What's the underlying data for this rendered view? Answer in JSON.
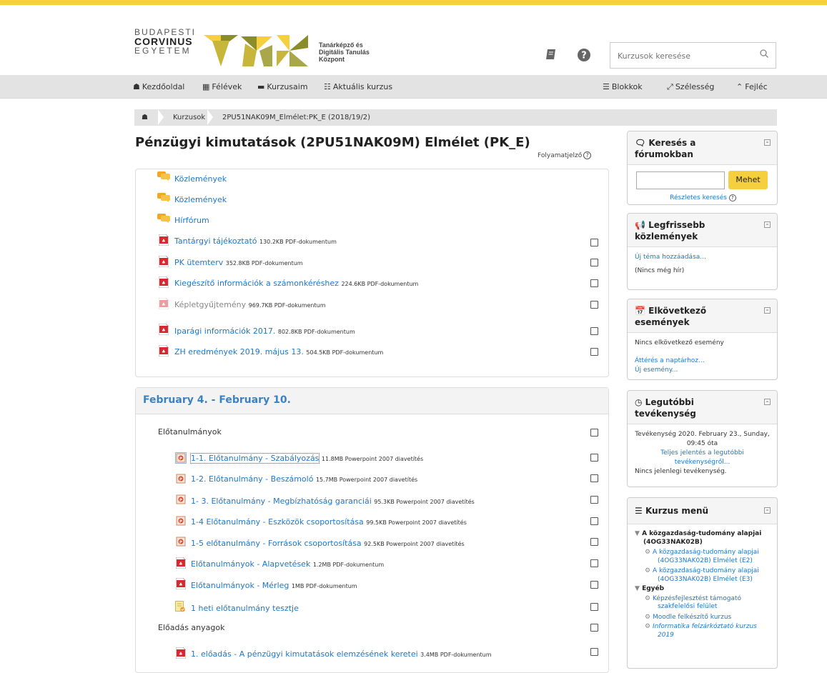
{
  "header": {
    "logo_line1": "BUDAPESTI",
    "logo_line2": "CORVINUS",
    "logo_line3": "EGYETEM",
    "tdk_line1": "Tanárképző és",
    "tdk_line2": "Digitális Tanulás",
    "tdk_line3": "Központ",
    "search_placeholder": "Kurzusok keresése",
    "brand_color": "#f6cf3e"
  },
  "nav": {
    "home": "Kezdőoldal",
    "semesters": "Félévek",
    "my_courses": "Kurzusaim",
    "current_course": "Aktuális kurzus",
    "blocks": "Blokkok",
    "width": "Szélesség",
    "header_toggle": "Fejléc"
  },
  "breadcrumb": {
    "courses": "Kurzusok",
    "current": "2PU51NAK09M_Elmélet:PK_E (2018/19/2)"
  },
  "page": {
    "title": "Pénzügyi kimutatások (2PU51NAK09M) Elmélet (PK_E)",
    "progress_label": "Folyamatjelző"
  },
  "section0": {
    "activities": [
      {
        "name": "Közlemények",
        "meta": "",
        "icon": "forum-icon"
      },
      {
        "name": "Közlemények",
        "meta": "",
        "icon": "forum-icon"
      },
      {
        "name": "Hírfórum",
        "meta": "",
        "icon": "forum-icon"
      },
      {
        "name": "Tantárgyi tájékoztató",
        "meta": "130.2KB PDF-dokumentum",
        "icon": "pdf-icon"
      },
      {
        "name": "PK ütemterv",
        "meta": "352.8KB PDF-dokumentum",
        "icon": "pdf-icon"
      },
      {
        "name": "Kiegészítő információk a számonkéréshez",
        "meta": "224.6KB PDF-dokumentum",
        "icon": "pdf-icon"
      },
      {
        "name": "Képletgyűjtemény",
        "meta": "969.7KB PDF-dokumentum",
        "icon": "pdf-icon"
      },
      {
        "name": "Iparági információk 2017.",
        "meta": "802.8KB PDF-dokumentum",
        "icon": "pdf-icon"
      },
      {
        "name": "ZH eredmények 2019. május 13.",
        "meta": "504.5KB PDF-dokumentum",
        "icon": "pdf-icon"
      }
    ]
  },
  "section1": {
    "title": "February 4. - February 10.",
    "label1": "Előtanulmányok",
    "label2": "Előadás anyagok",
    "activities": [
      {
        "name": "1-1. Előtanulmány - Szabályozás",
        "meta": "11.8MB Powerpoint 2007 diavetítés",
        "icon": "ppt-icon"
      },
      {
        "name": "1-2. Előtanulmány - Beszámoló",
        "meta": "15.7MB Powerpoint 2007 diavetítés",
        "icon": "ppt-icon"
      },
      {
        "name": "1- 3. Előtanulmány - Megbízhatóság garanciái",
        "meta": "95.3KB Powerpoint 2007 diavetítés",
        "icon": "ppt-icon"
      },
      {
        "name": "1-4 Előtanulmány - Eszközök csoportosítása",
        "meta": "99.5KB Powerpoint 2007 diavetítés",
        "icon": "ppt-icon"
      },
      {
        "name": "1-5 előtanulmány - Források csoportosítása",
        "meta": "92.5KB Powerpoint 2007 diavetítés",
        "icon": "ppt-icon"
      },
      {
        "name": "Előtanulmányok - Alapvetések",
        "meta": "1.2MB PDF-dokumentum",
        "icon": "pdf-icon"
      },
      {
        "name": "Előtanulmányok - Mérleg",
        "meta": "1MB PDF-dokumentum",
        "icon": "pdf-icon"
      },
      {
        "name": "1 heti előtanulmány tesztje",
        "meta": "",
        "icon": "quiz-icon"
      },
      {
        "name": "1. előadás - A pénzügyi kimutatások elemzésének keretei",
        "meta": "3.4MB PDF-dokumentum",
        "icon": "pdf-icon"
      }
    ]
  },
  "blocks": {
    "forum_search": {
      "title": "Keresés a fórumokban",
      "button": "Mehet",
      "advanced": "Részletes keresés"
    },
    "news": {
      "title_line1": "Legfrissebb",
      "title_line2": "közlemények",
      "add": "Új téma hozzáadása...",
      "empty": "(Nincs még hír)"
    },
    "events": {
      "title": "Elkövetkező események",
      "empty": "Nincs elkövetkező esemény",
      "calendar_link": "Áttérés a naptárhoz...",
      "new_event": "Új esemény..."
    },
    "recent": {
      "title": "Legutóbbi tevékenység",
      "since_line1": "Tevékenység 2020. February 23., Sunday,",
      "since_line2": "09:45 óta",
      "report_line1": "Teljes jelentés a legutóbbi",
      "report_line2": "tevékenységről...",
      "none": "Nincs jelenlegi tevékenység."
    },
    "course_menu": {
      "title": "Kurzus menü",
      "cat1_line1": "A közgazdaság-tudomány alapjai",
      "cat1_line2": "(4OG33NAK02B)",
      "c1_line1": "A közgazdaság-tudomány alapjai",
      "c1_line2": "(4OG33NAK02B) Elmélet (E2)",
      "c2_line1": "A közgazdaság-tudomány alapjai",
      "c2_line2": "(4OG33NAK02B) Elmélet (E3)",
      "cat2": "Egyéb",
      "c3_line1": "Képzésfejlesztést támogató",
      "c3_line2": "szakfelelősi felület",
      "c4": "Moodle felkészítő kurzus",
      "c5_line1": "Informatika felzárkóztató kurzus",
      "c5_line2": "2019"
    }
  }
}
